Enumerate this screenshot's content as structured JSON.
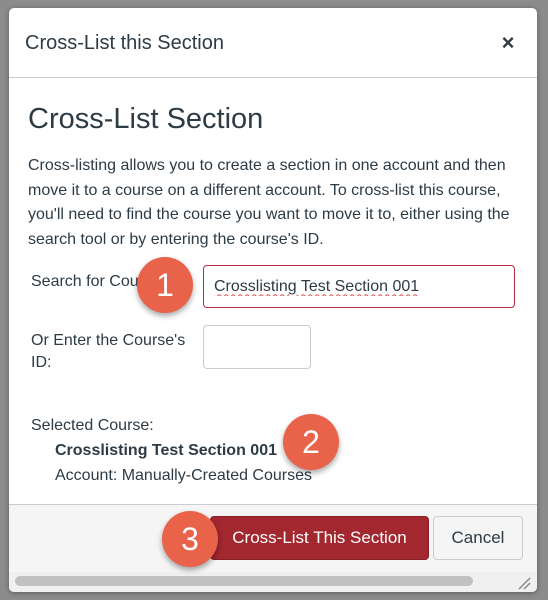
{
  "dialog": {
    "title": "Cross-List this Section",
    "close_glyph": "×"
  },
  "main": {
    "heading": "Cross-List Section",
    "description": "Cross-listing allows you to create a section in one account and then move it to a course on a different account. To cross-list this course, you'll need to find the course you want to move it to, either using the search tool or by entering the course's ID.",
    "search_label": "Search for Course",
    "search_value": "Crosslisting Test Section 001",
    "id_label": "Or Enter the Course's ID:",
    "id_value": "",
    "selected_label": "Selected Course:",
    "selected_course": "Crosslisting Test Section 001",
    "selected_account": "Account: Manually-Created Courses"
  },
  "footer": {
    "crosslist_button": "Cross-List This Section",
    "cancel_button": "Cancel"
  },
  "annotations": {
    "badge1": "1",
    "badge2": "2",
    "badge3": "3"
  },
  "colors": {
    "primary": "#a3272f",
    "badge": "#e9624a",
    "text": "#2d3b45"
  }
}
